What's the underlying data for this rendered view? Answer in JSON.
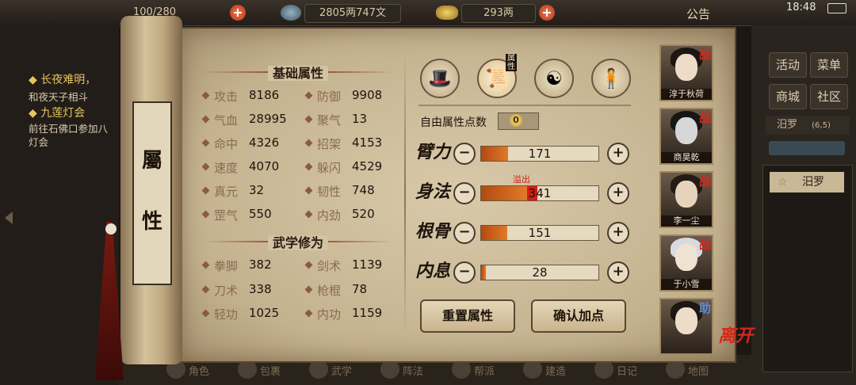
{
  "status_bar": {
    "time": "18:48"
  },
  "top_bar": {
    "stamina": "100/280",
    "copper_icon": "copper-coins-icon",
    "copper": "2805两747文",
    "silver_icon": "silver-ingot-icon",
    "silver": "293两",
    "notice": "公告"
  },
  "quests": [
    {
      "title": "长夜难明，",
      "desc": "和夜天子相斗"
    },
    {
      "title": "九莲灯会",
      "desc": "前往石佛口参加八",
      "desc2": "灯会"
    }
  ],
  "scroll": {
    "char1": "屬",
    "char2": "性"
  },
  "base_attrs": {
    "title": "基础属性",
    "stats": [
      {
        "name": "攻击",
        "value": "8186"
      },
      {
        "name": "防御",
        "value": "9908"
      },
      {
        "name": "气血",
        "value": "28995"
      },
      {
        "name": "聚气",
        "value": "13"
      },
      {
        "name": "命中",
        "value": "4326"
      },
      {
        "name": "招架",
        "value": "4153"
      },
      {
        "name": "速度",
        "value": "4070"
      },
      {
        "name": "躲闪",
        "value": "4529"
      },
      {
        "name": "真元",
        "value": "32"
      },
      {
        "name": "韧性",
        "value": "748"
      },
      {
        "name": "罡气",
        "value": "550"
      },
      {
        "name": "内劲",
        "value": "520"
      }
    ]
  },
  "martial_attrs": {
    "title": "武学修为",
    "stats": [
      {
        "name": "拳脚",
        "value": "382"
      },
      {
        "name": "剑术",
        "value": "1139"
      },
      {
        "name": "刀术",
        "value": "338"
      },
      {
        "name": "枪棍",
        "value": "78"
      },
      {
        "name": "轻功",
        "value": "1025"
      },
      {
        "name": "内功",
        "value": "1159"
      }
    ]
  },
  "category_tabs": [
    {
      "icon": "hat-icon",
      "glyph": "🎩"
    },
    {
      "icon": "scroll-icon",
      "glyph": "📜",
      "label": "属性"
    },
    {
      "icon": "bagua-icon",
      "glyph": "☯"
    },
    {
      "icon": "body-figure-icon",
      "glyph": "🧍"
    }
  ],
  "free_points": {
    "label": "自由属性点数",
    "value": "0"
  },
  "attributes": [
    {
      "name": "臂力",
      "value": "171",
      "fill": 0.23
    },
    {
      "name": "身法",
      "value": "341",
      "fill": 0.39,
      "overflow": 0.09,
      "overflow_label": "溢出"
    },
    {
      "name": "根骨",
      "value": "151",
      "fill": 0.22
    },
    {
      "name": "内息",
      "value": "28",
      "fill": 0.04
    }
  ],
  "buttons": {
    "reset": "重置属性",
    "confirm": "确认加点"
  },
  "party": [
    {
      "name": "淳于秋荷",
      "badge": "战",
      "hair": "#1d1612",
      "face": "#ecdcc8"
    },
    {
      "name": "商昊乾",
      "badge": "战",
      "hair": "#161616",
      "face": "#d7d7d7"
    },
    {
      "name": "李一尘",
      "badge": "战",
      "hair": "#241b14",
      "face": "#e6d3bc"
    },
    {
      "name": "于小雪",
      "badge": "战",
      "hair": "#d9d9df",
      "face": "#efe2d2"
    },
    {
      "name": "",
      "badge": "助",
      "hair": "#1d1612",
      "face": "#ecdcc8"
    }
  ],
  "leave_label": "离开",
  "right_menu": {
    "activity": "活动",
    "menu": "菜单",
    "shop": "商城",
    "community": "社区",
    "location": "汨罗",
    "coords": "(6,5)",
    "map_entry": "汨罗"
  },
  "bottom_bar": [
    {
      "icon": "character-icon",
      "label": "角色"
    },
    {
      "icon": "bag-icon",
      "label": "包裹"
    },
    {
      "icon": "martial-icon",
      "label": "武学"
    },
    {
      "icon": "formation-icon",
      "label": "阵法"
    },
    {
      "icon": "gang-icon",
      "label": "帮派"
    },
    {
      "icon": "build-icon",
      "label": "建造"
    },
    {
      "icon": "journal-icon",
      "label": "日记"
    },
    {
      "icon": "map-icon",
      "label": "地图"
    }
  ]
}
